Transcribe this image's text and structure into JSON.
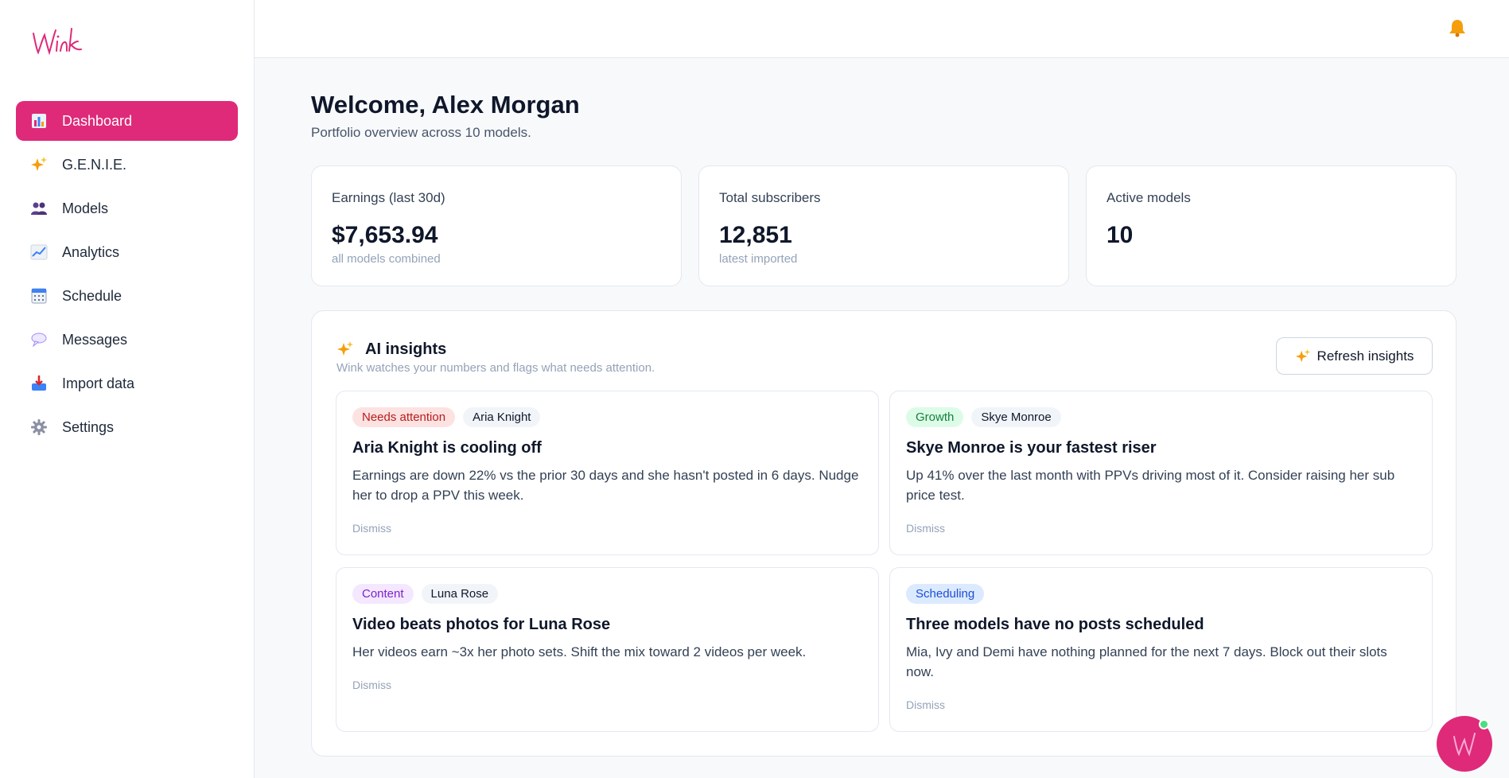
{
  "sidebar": {
    "logo_text": "Wink",
    "items": [
      {
        "label": "Dashboard",
        "icon": "bar-chart-icon",
        "active": true
      },
      {
        "label": "G.E.N.I.E.",
        "icon": "sparkles-icon"
      },
      {
        "label": "Models",
        "icon": "people-icon"
      },
      {
        "label": "Analytics",
        "icon": "line-chart-icon"
      },
      {
        "label": "Schedule",
        "icon": "calendar-icon"
      },
      {
        "label": "Messages",
        "icon": "speech-bubble-icon"
      },
      {
        "label": "Import data",
        "icon": "inbox-tray-icon"
      },
      {
        "label": "Settings",
        "icon": "gear-icon"
      }
    ]
  },
  "topbar": {
    "notification_icon": "bell-icon"
  },
  "header": {
    "title": "Welcome, Alex Morgan",
    "subtitle": "Portfolio overview across 10 models."
  },
  "stats": [
    {
      "label": "Earnings (last 30d)",
      "value": "$7,653.94",
      "note": "all models combined"
    },
    {
      "label": "Total subscribers",
      "value": "12,851",
      "note": "latest imported"
    },
    {
      "label": "Active models",
      "value": "10",
      "note": ""
    }
  ],
  "insights": {
    "title": "AI insights",
    "subtitle": "Wink watches your numbers and flags what needs attention.",
    "refresh_label": "Refresh insights",
    "cards": [
      {
        "tag": "Needs attention",
        "model": "Aria Knight",
        "title": "Aria Knight is cooling off",
        "body": "Earnings are down 22% vs the prior 30 days and she hasn't posted in 6 days. Nudge her to drop a PPV this week.",
        "dismiss": "Dismiss"
      },
      {
        "tag": "Growth",
        "model": "Skye Monroe",
        "title": "Skye Monroe is your fastest riser",
        "body": "Up 41% over the last month with PPVs driving most of it. Consider raising her sub price test.",
        "dismiss": "Dismiss"
      },
      {
        "tag": "Content",
        "model": "Luna Rose",
        "title": "Video beats photos for Luna Rose",
        "body": "Her videos earn ~3x her photo sets. Shift the mix toward 2 videos per week.",
        "dismiss": "Dismiss"
      },
      {
        "tag": "Scheduling",
        "model": "",
        "title": "Three models have no posts scheduled",
        "body": "Mia, Ivy and Demi have nothing planned for the next 7 days. Block out their slots now.",
        "dismiss": "Dismiss"
      }
    ]
  },
  "colors": {
    "accent": "#de2a79",
    "online": "#4ade80"
  }
}
